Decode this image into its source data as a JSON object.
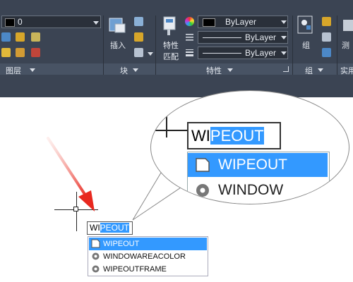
{
  "ribbon": {
    "layer_dropdown_value": "0",
    "groups": {
      "layers": "图层",
      "block": "块",
      "properties": "特性",
      "group": "组",
      "utilities": "实用"
    },
    "insert_label": "插入",
    "match_props_label_line1": "特性",
    "match_props_label_line2": "匹配",
    "group_label": "组",
    "measure_label": "测",
    "color_select": "ByLayer",
    "linetype_select": "ByLayer",
    "lineweight_select": "ByLayer"
  },
  "command": {
    "typed_prefix": "WI",
    "autocompleted_suffix": "PEOUT"
  },
  "autocomplete": {
    "items": [
      {
        "label": "WIPEOUT",
        "icon": "wipeout-icon",
        "selected": true
      },
      {
        "label": "WINDOWAREACOLOR",
        "icon": "gear-icon",
        "selected": false
      },
      {
        "label": "WIPEOUTFRAME",
        "icon": "gear-icon",
        "selected": false
      }
    ]
  },
  "magnifier": {
    "typed_prefix": "WI",
    "autocompleted_suffix": "PEOUT",
    "item_1": "WIPEOUT",
    "item_2_partial": "WINDOW"
  },
  "colors": {
    "ribbon_bg": "#3b4453",
    "selection_blue": "#3399ff",
    "annotation_arrow": "#e8281f"
  }
}
